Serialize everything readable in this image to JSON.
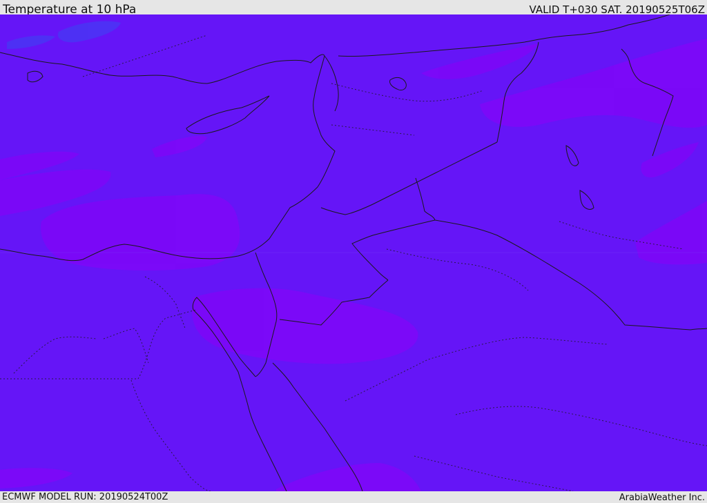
{
  "header": {
    "title": "Temperature at 10 hPa",
    "valid_time": "VALID T+030 SAT. 20190525T06Z"
  },
  "footer": {
    "model_run": "ECMWF MODEL RUN: 20190524T00Z",
    "credit": "ArabiaWeather Inc."
  },
  "map": {
    "field": "temperature",
    "level": "10 hPa",
    "colors": {
      "base": "#6515f7",
      "warm_patch": "#7c08f8",
      "cool_patch": "#4b33f4",
      "coastline": "#1a1a1a",
      "border": "#1a1a1a"
    }
  }
}
